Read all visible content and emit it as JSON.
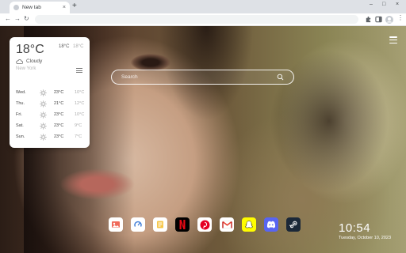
{
  "browser": {
    "tab_title": "New tab",
    "tab_close": "×",
    "new_tab": "+",
    "window_minimize": "–",
    "window_maximize": "□",
    "window_close": "×"
  },
  "weather": {
    "current_temp": "18°C",
    "high": "18°C",
    "low": "18°C",
    "condition": "Cloudy",
    "city": "New York",
    "forecast": [
      {
        "day": "Wed.",
        "high": "23°C",
        "low": "10°C"
      },
      {
        "day": "Thu.",
        "high": "21°C",
        "low": "12°C"
      },
      {
        "day": "Fri.",
        "high": "23°C",
        "low": "10°C"
      },
      {
        "day": "Sat.",
        "high": "23°C",
        "low": "9°C"
      },
      {
        "day": "Sun.",
        "high": "23°C",
        "low": "7°C"
      }
    ]
  },
  "search": {
    "placeholder": "Search"
  },
  "dock": {
    "apps": [
      "photos-icon",
      "speedtest-icon",
      "notes-icon",
      "netflix-icon",
      "pinterest-icon",
      "gmail-icon",
      "snapchat-icon",
      "discord-icon",
      "steam-icon"
    ]
  },
  "clock": {
    "time": "10:54",
    "date": "Tuesday, October 10, 2023"
  },
  "colors": {
    "netflix": "#e50914",
    "pinterest": "#e60023",
    "snapchat": "#fffc00",
    "discord": "#5865f2",
    "steam": "#1b2838"
  }
}
